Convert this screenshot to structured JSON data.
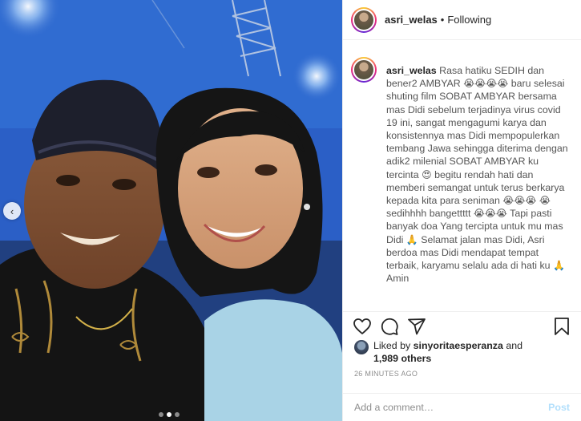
{
  "post": {
    "username": "asri_welas",
    "separator": "•",
    "follow_status": "Following"
  },
  "caption": {
    "username": "asri_welas",
    "part1": "Rasa hatiku SEDIH dan bener2 AMBYAR",
    "emoji_cry4": "😭😭😭😭",
    "part2": "baru selesai shuting film SOBAT AMBYAR bersama mas Didi sebelum terjadinya virus covid 19 ini, sangat mengagumi karya dan konsistennya mas Didi mempopulerkan tembang Jawa sehingga diterima dengan adik2 milenial SOBAT AMBYAR ku tercinta",
    "emoji_love": "😍",
    "part3": "begitu rendah hati dan memberi semangat untuk terus berkarya kepada kita para seniman",
    "emoji_cry3a": "😭😭😭",
    "emoji_cry1": "😭",
    "part4": "sedihhhh bangettttt",
    "emoji_cry3b": "😭😭😭",
    "part5": "Tapi pasti banyak doa Yang tercipta untuk mu mas Didi",
    "emoji_pray1": "🙏",
    "part6": "Selamat jalan mas Didi, Asri berdoa mas Didi mendapat tempat terbaik, karyamu selalu ada di hati ku",
    "emoji_pray2": "🙏",
    "part7": "Amin"
  },
  "likes": {
    "prefix": "Liked by",
    "user": "sinyoritaesperanza",
    "and": "and",
    "others": "1,989 others"
  },
  "timestamp": "26 MINUTES AGO",
  "comment_box": {
    "placeholder": "Add a comment…",
    "post_label": "Post"
  },
  "icons": {
    "like": "heart-icon",
    "comment": "comment-icon",
    "share": "share-icon",
    "save": "bookmark-icon",
    "prev": "chevron-left-icon"
  },
  "carousel": {
    "count": 3,
    "active": 1
  },
  "colors": {
    "post_button_disabled": "#b2dffc",
    "muted_text": "#8e8e8e",
    "border": "#efefef"
  }
}
